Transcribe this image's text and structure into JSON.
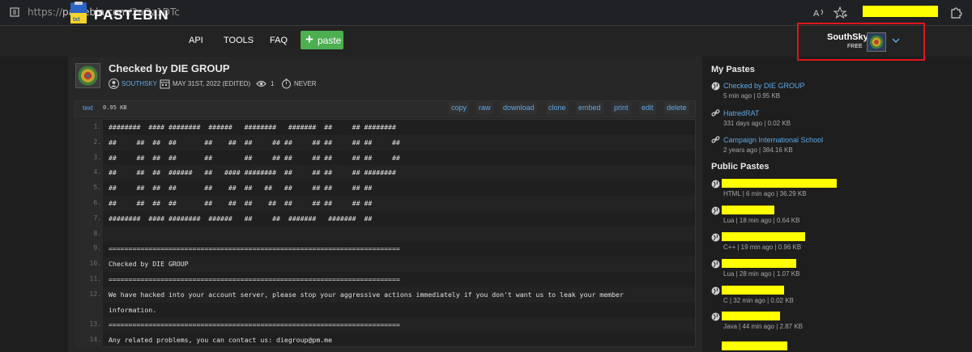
{
  "browser": {
    "url_prefix": "https://",
    "url_host": "pastebin.com",
    "url_path": "/2aQz1DTc"
  },
  "header": {
    "logo_text": "PASTEBIN",
    "nav": [
      "API",
      "TOOLS",
      "FAQ"
    ],
    "paste_button": "paste",
    "user_name": "SouthSky",
    "user_plan": "FREE"
  },
  "paste": {
    "title": "Checked by DIE GROUP",
    "author": "SOUTHSKY",
    "date": "MAY 31ST, 2022 (EDITED)",
    "views": "1",
    "expiry": "NEVER",
    "syntax": "text",
    "size": "0.95 KB",
    "actions": [
      "copy",
      "raw",
      "download",
      "clone",
      "embed",
      "print",
      "edit",
      "delete"
    ],
    "lines": [
      {
        "n": "1.",
        "text": "########  #### ########  ######   ########   #######  ##     ## ########"
      },
      {
        "n": "2.",
        "text": "##     ##  ##  ##       ##    ##  ##     ## ##     ## ##     ## ##     ##"
      },
      {
        "n": "3.",
        "text": "##     ##  ##  ##       ##        ##     ## ##     ## ##     ## ##     ##"
      },
      {
        "n": "4.",
        "text": "##     ##  ##  ######   ##   #### ########  ##     ## ##     ## ########"
      },
      {
        "n": "5.",
        "text": "##     ##  ##  ##       ##    ##  ##   ##   ##     ## ##     ## ##"
      },
      {
        "n": "6.",
        "text": "##     ##  ##  ##       ##    ##  ##    ##  ##     ## ##     ## ##"
      },
      {
        "n": "7.",
        "text": "########  #### ########  ######   ##     ##  #######   #######  ##"
      },
      {
        "n": "8.",
        "text": ""
      },
      {
        "n": "9.",
        "text": "========================================================================="
      },
      {
        "n": "10.",
        "text": "Checked by DIE GROUP"
      },
      {
        "n": "11.",
        "text": "========================================================================="
      },
      {
        "n": "12.",
        "text": "We have hacked into your account server, please stop your aggressive actions immediately if you don't want us to leak your member"
      },
      {
        "n": "",
        "text": "information."
      },
      {
        "n": "13.",
        "text": "========================================================================="
      },
      {
        "n": "14.",
        "text": "Any related problems, you can contact us: diegroup@pm.me"
      }
    ]
  },
  "sidebar": {
    "my_pastes_heading": "My Pastes",
    "my_pastes": [
      {
        "title": "Checked by DIE GROUP",
        "meta": "5 min ago | 0.95 KB",
        "icon": "globe-icon"
      },
      {
        "title": "HatredRAT",
        "meta": "331 days ago | 0.02 KB",
        "icon": "link-icon"
      },
      {
        "title": "Campaign International School",
        "meta": "2 years ago | 384.16 KB",
        "icon": "link-icon"
      }
    ],
    "public_pastes_heading": "Public Pastes",
    "public_pastes": [
      {
        "meta": "HTML | 6 min ago | 36.29 KB"
      },
      {
        "meta": "Lua | 18 min ago | 0.64 KB"
      },
      {
        "meta": "C++ | 19 min ago | 0.96 KB"
      },
      {
        "meta": "Lua | 28 min ago | 1.07 KB"
      },
      {
        "meta": "C | 32 min ago | 0.02 KB"
      },
      {
        "meta": "Java | 44 min ago | 2.87 KB"
      }
    ]
  },
  "colors": {
    "accent": "#5fa8e8",
    "paste_button": "#4caf50",
    "highlight_box": "#e0161d",
    "redaction": "#ffff00"
  }
}
